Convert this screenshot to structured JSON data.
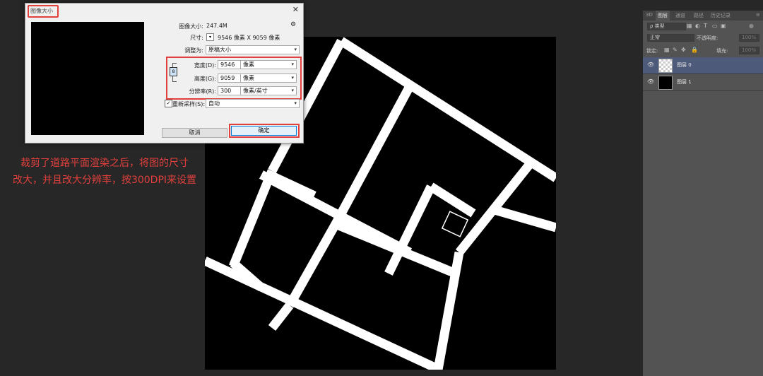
{
  "dialog": {
    "title": "图像大小",
    "image_size_label": "图像大小:",
    "image_size_value": "247.4M",
    "dimensions_label": "尺寸:",
    "dimensions_value": "9546 像素  X  9059 像素",
    "fit_label": "调整为:",
    "fit_value": "原稿大小",
    "width_label": "宽度(D):",
    "width_value": "9546",
    "width_unit": "像素",
    "height_label": "高度(G):",
    "height_value": "9059",
    "height_unit": "像素",
    "resolution_label": "分辨率(R):",
    "resolution_value": "300",
    "resolution_unit": "像素/英寸",
    "resample_label": "重新采样(S):",
    "resample_value": "自动",
    "cancel_label": "取消",
    "ok_label": "确定",
    "close_glyph": "✕",
    "gear_glyph": "⚙",
    "chain_glyph": "8",
    "dim_toggle_glyph": "▾",
    "check_glyph": "✓",
    "arrow_glyph": "▾"
  },
  "annotation": {
    "line1": "裁剪了道路平面渲染之后，将图的尺寸",
    "line2": "改大，并且改大分辨率，按300DPI来设置"
  },
  "panel": {
    "tabs": [
      "3D",
      "图层",
      "通道",
      "路径",
      "历史记录"
    ],
    "active_tab": "图层",
    "search_kind": "ρ 类型",
    "blend_mode": "正常",
    "opacity_label": "不透明度:",
    "opacity_value": "100%",
    "lock_label": "锁定:",
    "fill_label": "填充:",
    "fill_value": "100%",
    "layers": [
      {
        "name": "图层 0",
        "selected": true
      },
      {
        "name": "图层 1",
        "selected": false
      }
    ],
    "eye_glyph": "👁",
    "menu_glyph": "≡",
    "more_glyph": "»"
  },
  "colors": {
    "highlight_red": "#e2403d",
    "workspace": "#272727",
    "panel_bg": "#535353",
    "selected_layer": "#4d5a7a"
  }
}
